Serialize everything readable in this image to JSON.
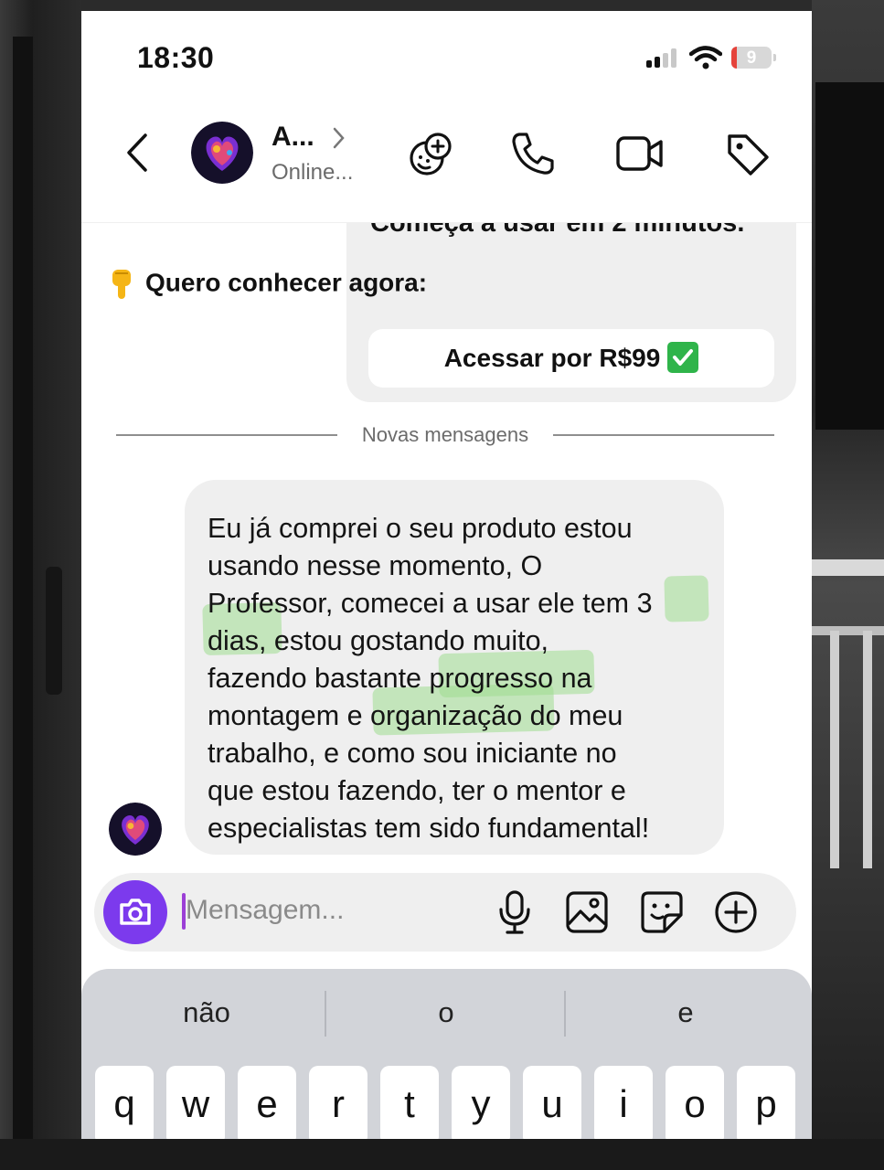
{
  "status_bar": {
    "time": "18:30",
    "battery_level": "9"
  },
  "header": {
    "contact_name": "A...",
    "contact_status": "Online...",
    "icons": [
      "back-icon",
      "chevron-right-icon",
      "emoji-add-icon",
      "phone-icon",
      "video-icon",
      "tag-icon"
    ]
  },
  "previous_message": {
    "partial_line": "Começa a usar em 2 minutos.",
    "cta": "Quero conhecer agora:",
    "button_label": "Acessar por R$99"
  },
  "divider": {
    "label": "Novas mensagens"
  },
  "message": {
    "lines": [
      "Eu já comprei o seu produto estou",
      "usando nesse momento, O",
      "Professor, comecei a usar ele tem 3",
      "dias, estou gostando muito,",
      "fazendo bastante progresso na",
      "montagem e organização do meu",
      "trabalho, e como sou iniciante no",
      "que estou fazendo, ter o mentor e",
      "especialistas tem sido fundamental!"
    ],
    "highlighted_words": [
      "3",
      "dias,",
      "progresso",
      "organização"
    ],
    "highlight_color": "#9fdc8f"
  },
  "composer": {
    "placeholder": "Mensagem...",
    "icons": [
      "camera-icon",
      "microphone-icon",
      "image-icon",
      "sticker-icon",
      "plus-circle-icon"
    ],
    "camera_color": "#7c3aed"
  },
  "keyboard": {
    "suggestions": [
      "não",
      "o",
      "e"
    ],
    "keys_row1": [
      "q",
      "w",
      "e",
      "r",
      "t",
      "y",
      "u",
      "i",
      "o",
      "p"
    ]
  }
}
